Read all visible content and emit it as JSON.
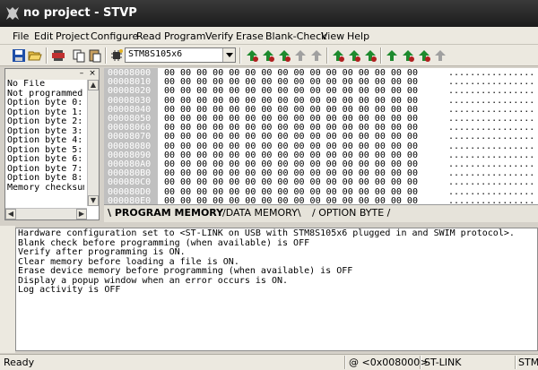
{
  "window": {
    "title": "no project - STVP"
  },
  "menu": [
    "File",
    "Edit",
    "Project",
    "Configure",
    "Read",
    "Program",
    "Verify",
    "Erase",
    "Blank-Check",
    "View",
    "Help"
  ],
  "toolbar": {
    "device": "STM8S105x6"
  },
  "left_panel": {
    "items": [
      "No File",
      "Not programmed",
      "Option byte 0:",
      "Option byte 1:",
      "Option byte 2:",
      "Option byte 3:",
      "Option byte 4:",
      "Option byte 5:",
      "Option byte 6:",
      "Option byte 7:",
      "Option byte 8:",
      "Memory checksum"
    ]
  },
  "memory": {
    "bytes": "00 00 00 00 00 00 00 00 00 00 00 00 00 00 00 00",
    "ascii": "................",
    "addresses": [
      "00008000",
      "00008010",
      "00008020",
      "00008030",
      "00008040",
      "00008050",
      "00008060",
      "00008070",
      "00008080",
      "00008090",
      "000080A0",
      "000080B0",
      "000080C0",
      "000080D0",
      "000080E0"
    ]
  },
  "tabs": [
    "PROGRAM MEMORY",
    "DATA MEMORY",
    "OPTION BYTE"
  ],
  "log": {
    "lines": [
      "Hardware configuration set to <ST-LINK on USB with STM8S105x6 plugged in and SWIM protocol>.",
      "Blank check before programming (when available) is OFF",
      "Verify after programming is ON.",
      "Clear memory before loading a file is ON.",
      "Erase device memory before programming (when available) is OFF",
      "Display a popup window when an error occurs is ON.",
      "Log activity is OFF"
    ]
  },
  "status": {
    "ready": "Ready",
    "address": "@ <0x008000>",
    "link": "ST-LINK",
    "device": "STM"
  }
}
